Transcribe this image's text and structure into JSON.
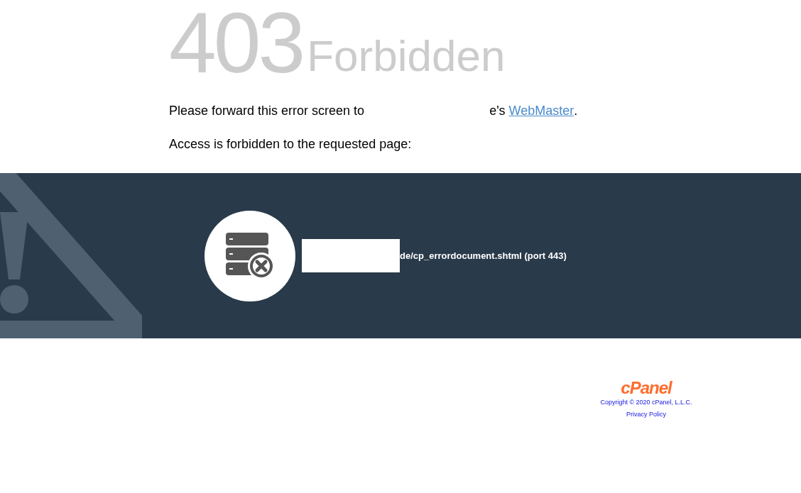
{
  "heading": {
    "code": "403",
    "text": "Forbidden"
  },
  "message": {
    "before": "Please forward this error screen to",
    "after": "e's",
    "link": "WebMaster",
    "end": "."
  },
  "access": "Access is forbidden to the requested page:",
  "error_path": "de/cp_errordocument.shtml (port 443)",
  "footer": {
    "logo": "cPanel",
    "copyright": "Copyright © 2020 cPanel, L.L.C.",
    "privacy": "Privacy Policy"
  }
}
